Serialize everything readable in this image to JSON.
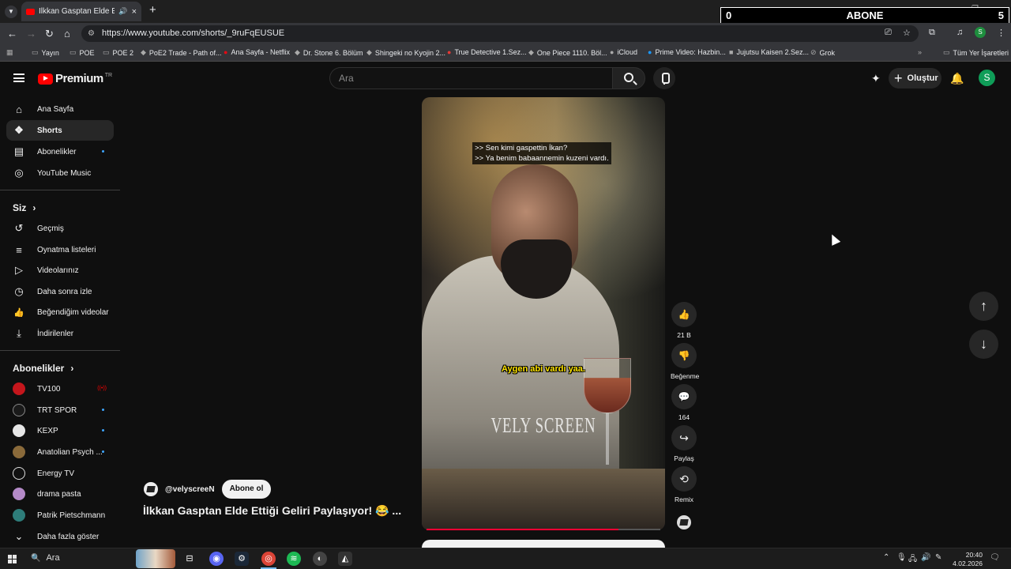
{
  "browser": {
    "tab_title": "İlkkan Gasptan Elde Ettiği G",
    "new_tab_symbol": "+",
    "url": "https://www.youtube.com/shorts/_9ruFqEUSUE",
    "profile_initial": "S",
    "bookmarks": [
      {
        "label": "Yayın",
        "icon": "folder-icon"
      },
      {
        "label": "POE",
        "icon": "folder-icon"
      },
      {
        "label": "POE 2",
        "icon": "folder-icon"
      },
      {
        "label": "PoE2 Trade - Path of...",
        "icon": "site-icon"
      },
      {
        "label": "Ana Sayfa - Netflix",
        "icon": "netflix-icon"
      },
      {
        "label": "Dr. Stone 6. Bölüm",
        "icon": "site-icon"
      },
      {
        "label": "Shingeki no Kyojin 2...",
        "icon": "site-icon"
      },
      {
        "label": "True Detective 1.Sez...",
        "icon": "site-icon"
      },
      {
        "label": "One Piece 1110. Böl...",
        "icon": "site-icon"
      },
      {
        "label": "iCloud",
        "icon": "icloud-icon"
      },
      {
        "label": "Prime Video: Hazbin...",
        "icon": "prime-icon"
      },
      {
        "label": "Jujutsu Kaisen 2.Sez...",
        "icon": "site-icon"
      },
      {
        "label": "Grok",
        "icon": "grok-icon"
      }
    ],
    "all_bookmarks": "Tüm Yer İşaretleri"
  },
  "overlay": {
    "left": "0",
    "center": "ABONE",
    "right": "5"
  },
  "youtube": {
    "logo_text": "Premium",
    "logo_region": "TR",
    "search_placeholder": "Ara",
    "create_label": "Oluştur",
    "user_initial": "S"
  },
  "sidebar": {
    "main": [
      {
        "label": "Ana Sayfa",
        "icon": "home-icon",
        "glyph": "⌂"
      },
      {
        "label": "Shorts",
        "icon": "shorts-icon",
        "glyph": "❖"
      },
      {
        "label": "Abonelikler",
        "icon": "subscriptions-icon",
        "glyph": "▤"
      },
      {
        "label": "YouTube Music",
        "icon": "music-icon",
        "glyph": "◎"
      }
    ],
    "you_heading": "Siz",
    "you": [
      {
        "label": "Geçmiş",
        "icon": "history-icon",
        "glyph": "↺"
      },
      {
        "label": "Oynatma listeleri",
        "icon": "playlists-icon",
        "glyph": "≡"
      },
      {
        "label": "Videolarınız",
        "icon": "your-videos-icon",
        "glyph": "▷"
      },
      {
        "label": "Daha sonra izle",
        "icon": "watch-later-icon",
        "glyph": "◷"
      },
      {
        "label": "Beğendiğim videolar",
        "icon": "liked-icon",
        "glyph": "👍"
      },
      {
        "label": "İndirilenler",
        "icon": "download-icon",
        "glyph": "⤓"
      }
    ],
    "subs_heading": "Abonelikler",
    "subs": [
      {
        "label": "TV100",
        "color": "#c4161c",
        "badge": "live"
      },
      {
        "label": "TRT SPOR",
        "color": "#1a1a1a",
        "badge": "dot"
      },
      {
        "label": "KEXP",
        "color": "#e6e6e6",
        "badge": "dot"
      },
      {
        "label": "Anatolian Psych ...",
        "color": "#8a6a3a",
        "badge": "dot"
      },
      {
        "label": "Energy TV",
        "color": "#111111",
        "badge": ""
      },
      {
        "label": "drama pasta",
        "color": "#b48ac8",
        "badge": ""
      },
      {
        "label": "Patrik Pietschmann",
        "color": "#2e7d7a",
        "badge": ""
      }
    ],
    "show_more": "Daha fazla göster"
  },
  "short": {
    "subtitle_line1": ">> Sen kimi gaspettin İkan?",
    "subtitle_line2": ">> Ya benim babaannemin kuzeni vardı.",
    "caption": "Aygen abi vardı yaa.",
    "watermark": "VELY SCREEN",
    "progress": 0.82,
    "channel": "@velyscreeN",
    "subscribe": "Abone ol",
    "title": "İlkkan Gasptan Elde Ettiği Geliri Paylaşıyor! 😂 ..."
  },
  "actions": [
    {
      "label": "21 B",
      "icon": "like-icon",
      "glyph": "👍"
    },
    {
      "label": "Beğenme",
      "icon": "dislike-icon",
      "glyph": "👎"
    },
    {
      "label": "164",
      "icon": "comment-icon",
      "glyph": "💬"
    },
    {
      "label": "Paylaş",
      "icon": "share-icon",
      "glyph": "↪"
    },
    {
      "label": "Remix",
      "icon": "remix-icon",
      "glyph": "⟲"
    }
  ],
  "taskbar": {
    "search": "Ara",
    "time": "20:40",
    "date": "4.02.2026"
  }
}
